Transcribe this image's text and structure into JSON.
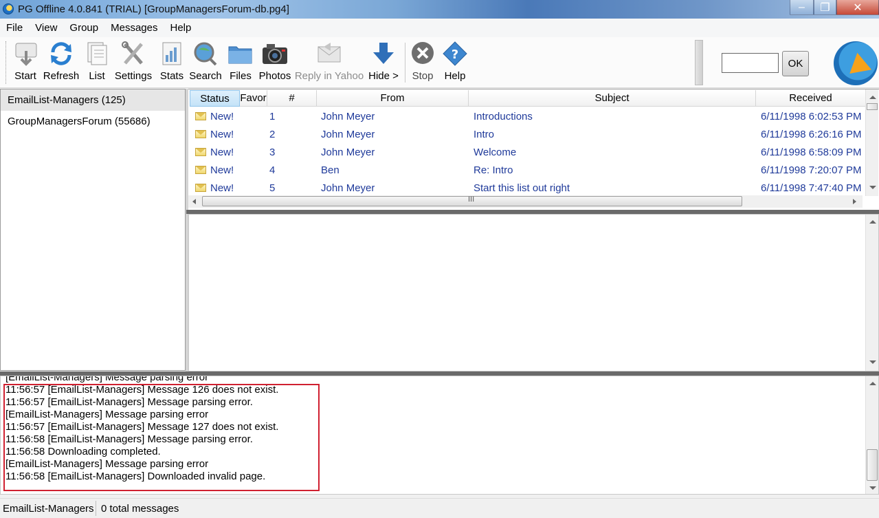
{
  "window": {
    "title": "PG Offline 4.0.841 (TRIAL) [GroupManagersForum-db.pg4]",
    "controls": [
      "–",
      "❐",
      "✕"
    ]
  },
  "menu": [
    "File",
    "View",
    "Group",
    "Messages",
    "Help"
  ],
  "toolbar": {
    "buttons": [
      {
        "label": "Start",
        "icon": "start-icon",
        "enabled": true
      },
      {
        "label": "Refresh",
        "icon": "refresh-icon",
        "enabled": true
      },
      {
        "label": "List",
        "icon": "list-icon",
        "enabled": true
      },
      {
        "label": "Settings",
        "icon": "settings-icon",
        "enabled": true
      },
      {
        "label": "Stats",
        "icon": "stats-icon",
        "enabled": true
      },
      {
        "label": "Search",
        "icon": "search-icon",
        "enabled": true
      },
      {
        "label": "Files",
        "icon": "files-icon",
        "enabled": true
      },
      {
        "label": "Photos",
        "icon": "camera-icon",
        "enabled": true
      },
      {
        "label": "Reply in Yahoo",
        "icon": "reply-icon",
        "enabled": false
      },
      {
        "label": "Hide >",
        "icon": "down-arrow-icon",
        "enabled": true
      },
      {
        "label": "Stop",
        "icon": "stop-icon",
        "enabled": true
      },
      {
        "label": "Help",
        "icon": "help-icon",
        "enabled": true
      }
    ],
    "input_value": "",
    "ok_label": "OK"
  },
  "folders": [
    {
      "label": "EmailList-Managers (125)",
      "selected": true
    },
    {
      "label": "GroupManagersForum (55686)",
      "selected": false
    }
  ],
  "message_list": {
    "columns": [
      "Status",
      "Favor",
      "#",
      "From",
      "Subject",
      "Received"
    ],
    "rows": [
      {
        "status": "New!",
        "num": "1",
        "from": "John Meyer",
        "subject": "Introductions",
        "received": "6/11/1998 6:02:53 PM"
      },
      {
        "status": "New!",
        "num": "2",
        "from": "John Meyer",
        "subject": "Intro",
        "received": "6/11/1998 6:26:16 PM"
      },
      {
        "status": "New!",
        "num": "3",
        "from": "John Meyer",
        "subject": "Welcome",
        "received": "6/11/1998 6:58:09 PM"
      },
      {
        "status": "New!",
        "num": "4",
        "from": "Ben",
        "subject": "Re: Intro",
        "received": "6/11/1998 7:20:07 PM"
      },
      {
        "status": "New!",
        "num": "5",
        "from": "John Meyer",
        "subject": "Start this list out right",
        "received": "6/11/1998 7:47:40 PM"
      }
    ],
    "hscroll_grip": "III"
  },
  "log": {
    "lines": [
      "[EmailList-Managers] Message parsing error",
      "11:56:57 [EmailList-Managers] Message 126 does not exist.",
      "11:56:57 [EmailList-Managers] Message parsing error.",
      "[EmailList-Managers] Message parsing error",
      "11:56:57 [EmailList-Managers] Message 127 does not exist.",
      "11:56:58 [EmailList-Managers] Message parsing error.",
      "11:56:58 Downloading completed.",
      "[EmailList-Managers] Message parsing error",
      "11:56:58 [EmailList-Managers] Downloaded invalid page."
    ]
  },
  "statusbar": {
    "group": "EmailList-Managers",
    "count": "0 total messages"
  },
  "colors": {
    "highlight_box": "#d02030",
    "link_text": "#1f3a9a"
  }
}
